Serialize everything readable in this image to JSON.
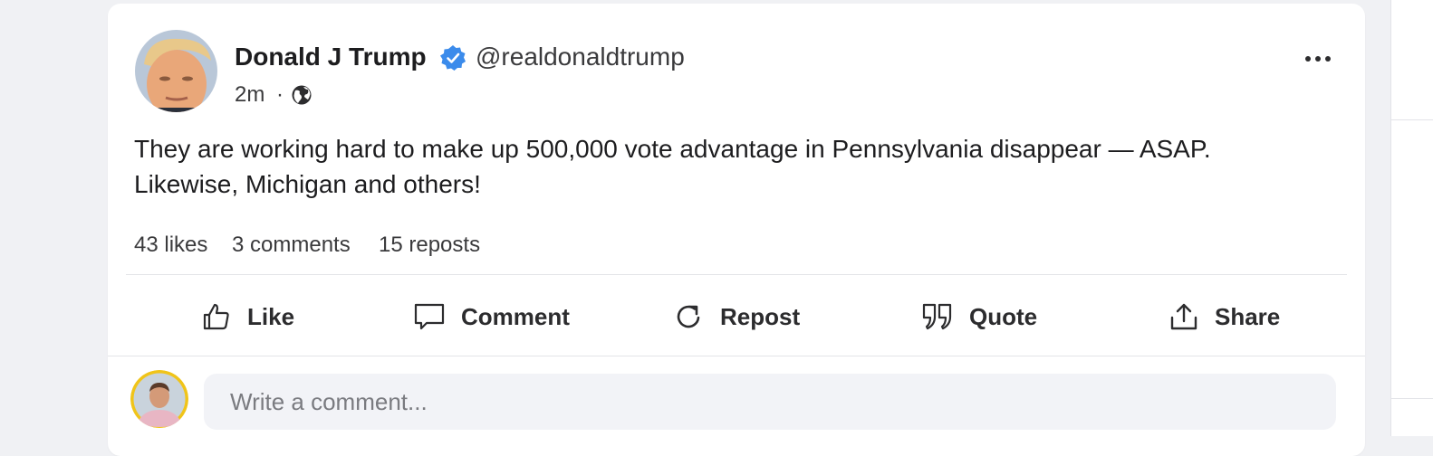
{
  "post": {
    "author_name": "Donald J Trump",
    "handle": "@realdonaldtrump",
    "verified": true,
    "time_ago": "2m",
    "separator": "·",
    "visibility_icon": "globe-icon",
    "more_icon": "ellipsis-icon",
    "body_line1": "They are working hard to make up 500,000 vote advantage in Pennsylvania disappear — ASAP.",
    "body_line2": "Likewise, Michigan and others!",
    "stats": {
      "likes": "43 likes",
      "comments": "3 comments",
      "reposts": "15 reposts"
    }
  },
  "actions": [
    {
      "label": "Like",
      "icon": "thumbs-up-icon"
    },
    {
      "label": "Comment",
      "icon": "speech-bubble-icon"
    },
    {
      "label": "Repost",
      "icon": "repost-icon"
    },
    {
      "label": "Quote",
      "icon": "quote-icon"
    },
    {
      "label": "Share",
      "icon": "share-icon"
    }
  ],
  "comment_box": {
    "placeholder": "Write a comment..."
  },
  "colors": {
    "verified_badge": "#3b8beb",
    "background": "#f0f1f4",
    "card": "#ffffff",
    "input_bg": "#f2f3f7",
    "commenter_ring": "#f0c419"
  }
}
